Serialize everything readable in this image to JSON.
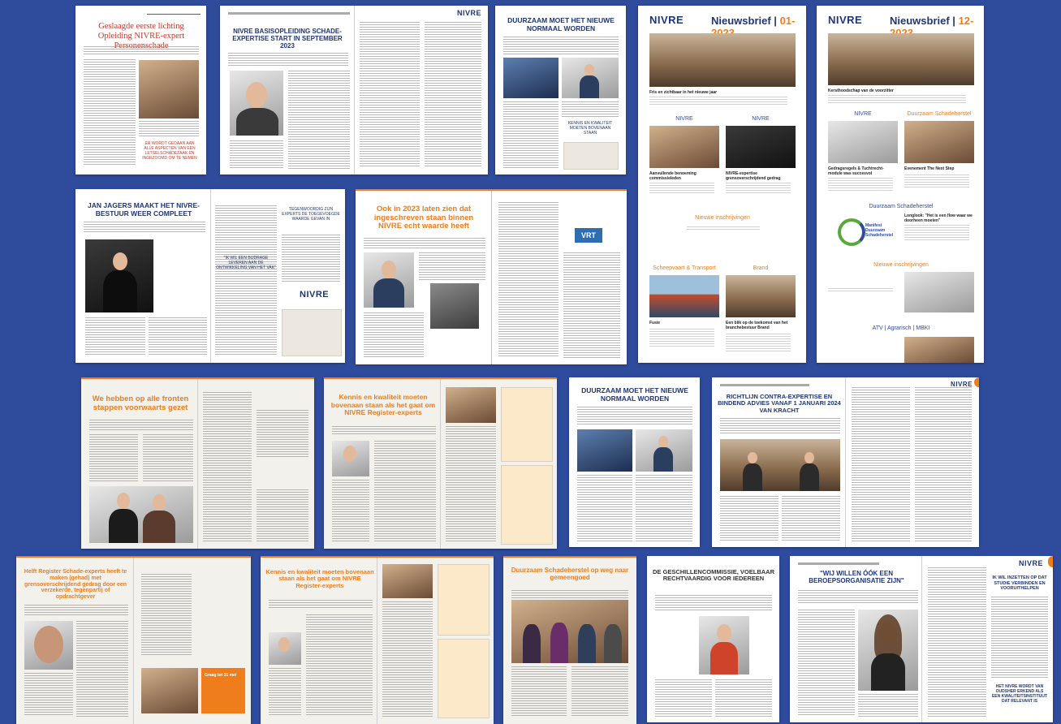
{
  "colors": {
    "background": "#2f4b9c",
    "accent": "#f07d1b",
    "navy": "#1f3576"
  },
  "logo_text": "NIVRE",
  "tiles": {
    "t1": {
      "title": "Geslaagde eerste lichting Opleiding NIVRE-expert Personenschade",
      "quote": "ER WORDT GEDAAN AAN ALLE ASPECTEN VAN EEN LETSELSCHADEZAAK EN INGEZOOMD OM TE NEMEN"
    },
    "t2": {
      "title": "NIVRE BASISOPLEIDING SCHADE-EXPERTISE START IN SEPTEMBER 2023"
    },
    "t3": {
      "title": "DUURZAAM MOET HET NIEUWE NORMAAL WORDEN",
      "quote": "KENNIS EN KWALITEIT MOETEN BOVENAAN STAAN"
    },
    "t4": {
      "title": "Nieuwsbrief | 01-2023",
      "title_main": "Nieuwsbrief |",
      "title_issue": "01-2023",
      "lead": "Fris en zichtbaar in het nieuwe jaar",
      "col1": "NIVRE",
      "col2": "NIVRE",
      "item1": "Aanvullende benoeming commissieleden",
      "item2": "NIVRE-expertise grensoverschrijdend gedrag",
      "sec_new": "Nieuwe inschrijvingen",
      "sec_ship": "Scheepvaart & Transport",
      "sec_fire": "Brand",
      "item3": "Fusie",
      "item4": "Een blik op de toekomst van het branchebestuur Brand"
    },
    "t5": {
      "title": "Nieuwsbrief | 12-2023",
      "title_main": "Nieuwsbrief |",
      "title_issue": "12-2023",
      "lead": "Kersthoodschap van de voorzitter",
      "col1": "NIVRE",
      "col2": "Duurzaam Schadeherstel",
      "item1": "Gedragsregels & Tuchtrecht-module was succesvol",
      "item2": "Evenement The Next Step",
      "sec_ds": "Duurzaam Schadeherstel",
      "manifest": "Manifest Duurzaam Schadeherstel",
      "item3": "Longlook: \"Het is een flow waar we doorheen moeten\"",
      "sec_new": "Nieuwe inschrijvingen",
      "sec_atv": "ATV | Agrarisch | MBKI"
    },
    "t6": {
      "title": "JAN JAGERS MAAKT HET NIVRE-BESTUUR WEER COMPLEET",
      "quote1": "TEGENWOORDIG ZIJN EXPERTS DE TOEGEVOEGDE WAARDE GEVAN IN",
      "quote2": "\"IK WIL EEN BIJDRAGE LEVEREN AAN DE ONTWIKKELING VAN HET VAK\""
    },
    "t7": {
      "title": "Ook in 2023 laten zien dat ingeschreven staan binnen NIVRE echt waarde heeft",
      "badge": "VRT"
    },
    "t8": {
      "title": "We hebben op alle fronten stappen voorwaarts gezet"
    },
    "t9": {
      "title": "Kennis en kwaliteit moeten bovenaan staan als het gaat om NIVRE Register-experts"
    },
    "t10": {
      "title": "DUURZAAM MOET HET NIEUWE NORMAAL WORDEN"
    },
    "t11": {
      "title": "RICHTLIJN CONTRA-EXPERTISE EN BINDEND ADVIES VANAF 1 JANUARI 2024 VAN KRACHT"
    },
    "t12": {
      "title": "Helft Register Schade-experts heeft te maken (gehad) met grensoverschrijdend gedrag door een verzekerde, tegenpartij of opdrachtgever",
      "banner": "Graag tot 31 mei"
    },
    "t13": {
      "title": "Kennis en kwaliteit moeten bovenaan staan als het gaat om NIVRE Register-experts"
    },
    "t14": {
      "title": "Duurzaam Schadeherstel op weg naar gemeengoed"
    },
    "t15": {
      "title": "DE GESCHILLENCOMMISSIE, VOELBAAR RECHTVAARDIG VOOR IEDEREEN"
    },
    "t16": {
      "title": "\"WIJ WILLEN ÓÓK EEN BEROEPSORGANISATIE ZIJN\"",
      "quote": "IK WIL INZETTEN OP DAT STUDIE VERBINDEN EN VOORUITHELPEN",
      "quote2": "HET NIVRE WORDT VAN OUDSHER ERKEND ALS EEN KWALITEITSINSTITUUT DAT RELEVANT IS"
    }
  }
}
